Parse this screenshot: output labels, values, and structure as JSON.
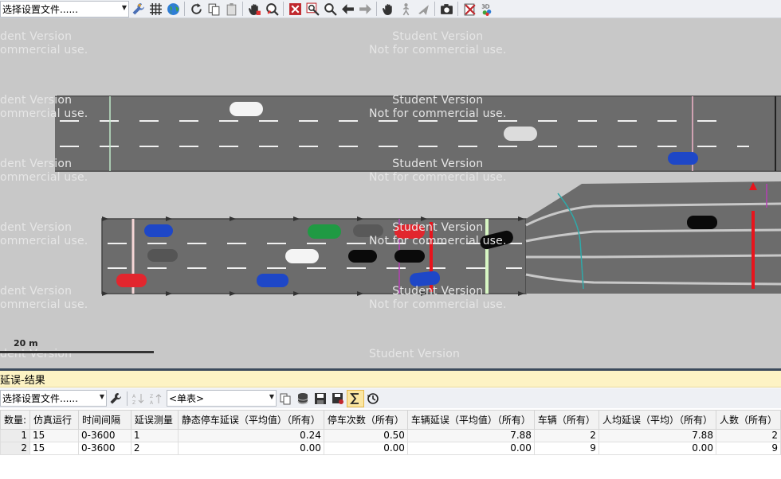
{
  "toolbar": {
    "layout_combo": "选择设置文件......",
    "icons": [
      "wrench-icon",
      "grid-icon",
      "globe-icon",
      "rotate-icon",
      "copy-icon",
      "clipboard-icon",
      "pan-hand-icon",
      "zoom-hand-icon",
      "zoom-fit-icon",
      "zoom-window-icon",
      "zoom-icon",
      "back-arrow-icon",
      "forward-arrow-icon",
      "hand-icon",
      "pedestrian-icon",
      "plane-icon",
      "camera-icon",
      "delete-view-icon",
      "3d-icon"
    ]
  },
  "canvas": {
    "watermark_line1": "Student Version",
    "watermark_line2": "Not for commercial use.",
    "watermark_left_line1": "dent Version",
    "watermark_left_line2": "ommercial use.",
    "watermark_left_partial": "dent Version",
    "watermark_bottom": "Student Version",
    "scale_label": "20 m",
    "colors": {
      "road": "#6c6c6c",
      "background": "#c8c8c8",
      "marking": "#f0f0f0",
      "signal_red": "#e8141c"
    }
  },
  "results": {
    "title": "延误-结果",
    "layout_combo": "选择设置文件......",
    "list_combo": "<单表>",
    "columns": [
      "数量:",
      "仿真运行",
      "时间间隔",
      "延误测量",
      "静态停车延误（平均值）（所有）",
      "停车次数（所有）",
      "车辆延误（平均值）（所有）",
      "车辆（所有）",
      "人均延误（平均）（所有）",
      "人数（所有）"
    ],
    "rows": [
      [
        "1",
        "15",
        "0-3600",
        "1",
        "0.24",
        "0.50",
        "7.88",
        "2",
        "7.88",
        "2"
      ],
      [
        "2",
        "15",
        "0-3600",
        "2",
        "0.00",
        "0.00",
        "0.00",
        "9",
        "0.00",
        "9"
      ]
    ]
  }
}
